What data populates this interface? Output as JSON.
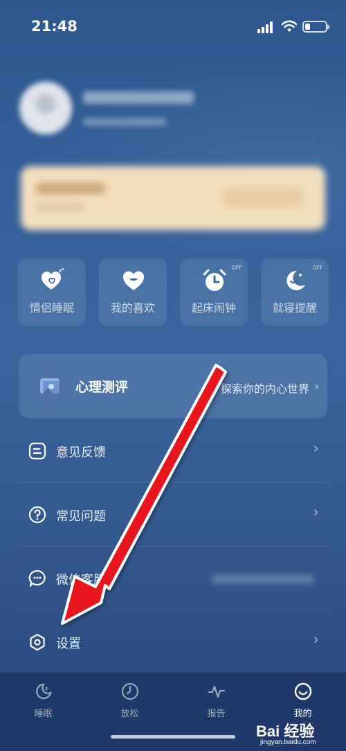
{
  "status_bar": {
    "time": "21:48"
  },
  "quick_actions": [
    {
      "label": "情侣睡眠",
      "icon": "heart-zzz-icon",
      "badge": ""
    },
    {
      "label": "我的喜欢",
      "icon": "heart-smile-icon",
      "badge": ""
    },
    {
      "label": "起床闹钟",
      "icon": "alarm-clock-icon",
      "badge": "OFF"
    },
    {
      "label": "就寝提醒",
      "icon": "moon-icon",
      "badge": "OFF"
    }
  ],
  "psych_test": {
    "title": "心理测评",
    "subtitle": "探索你的内心世界",
    "chevron": "›"
  },
  "menu": [
    {
      "label": "意见反馈",
      "icon": "feedback-icon"
    },
    {
      "label": "常见问题",
      "icon": "question-icon"
    },
    {
      "label": "微信客服",
      "icon": "wechat-service-icon"
    },
    {
      "label": "设置",
      "icon": "settings-icon"
    }
  ],
  "menu_chevron": "›",
  "tabbar": [
    {
      "label": "睡眠",
      "icon": "sleep-moon-icon"
    },
    {
      "label": "放松",
      "icon": "relax-icon"
    },
    {
      "label": "报告",
      "icon": "report-pulse-icon"
    },
    {
      "label": "我的",
      "icon": "profile-smile-icon",
      "active": true
    }
  ],
  "colors": {
    "background": "#35609a",
    "tabbar": "#1f3a6a",
    "arrow": "#e8141c",
    "vip_card": "#f3dfbd"
  },
  "watermark": {
    "logo": "Bai 经验",
    "url": "jingyan.baidu.com"
  }
}
